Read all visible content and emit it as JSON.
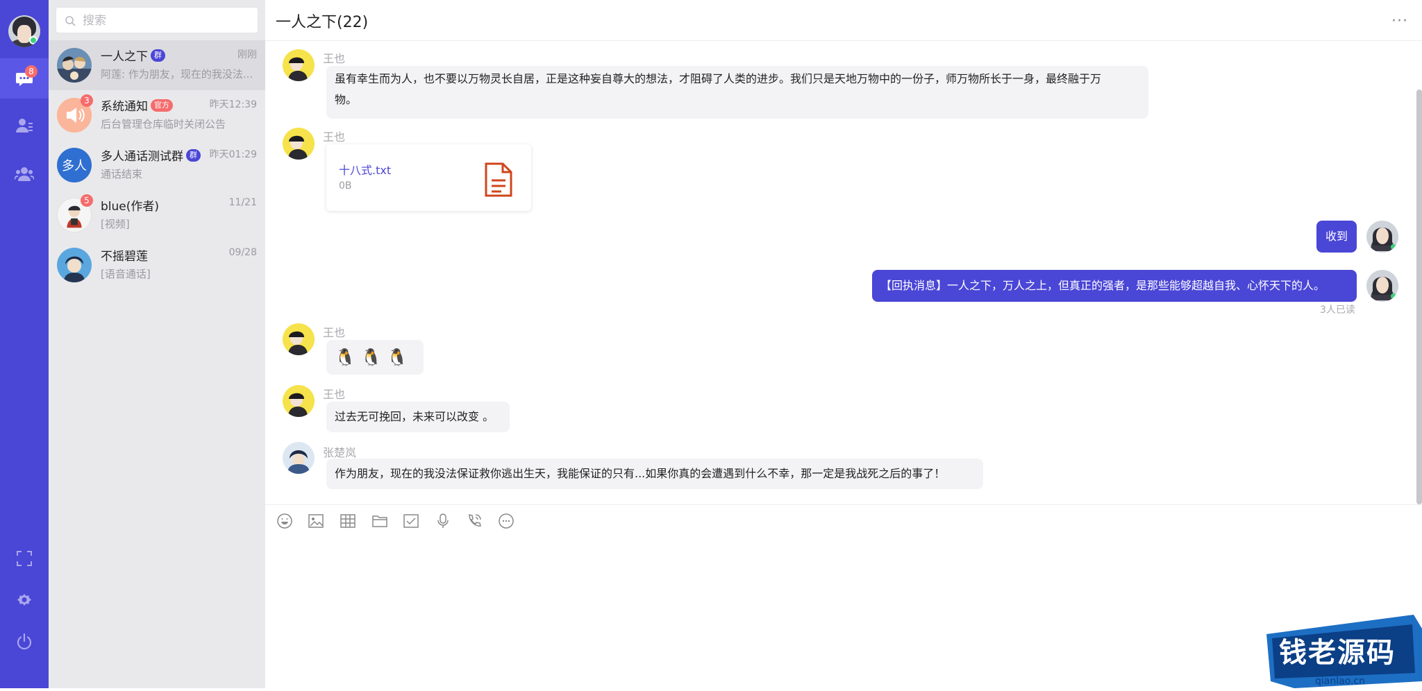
{
  "sidebar_rail": {
    "chat_badge": "8",
    "colors": {
      "rail": "#4a46d6",
      "active": "#5b57e6",
      "badge": "#f56c6c"
    },
    "icons": [
      "avatar",
      "chat-icon",
      "contacts-icon",
      "groups-icon",
      "fullscreen-icon",
      "gear-icon",
      "power-icon"
    ]
  },
  "search": {
    "placeholder": "搜索"
  },
  "conversations": [
    {
      "name": "一人之下",
      "tag": "群",
      "time": "刚刚",
      "preview": "阿莲: 作为朋友，现在的我没法...",
      "badge": ""
    },
    {
      "name": "系统通知",
      "tag": "官方",
      "time": "昨天12:39",
      "preview": "后台管理仓库临时关闭公告",
      "badge": "3"
    },
    {
      "name": "多人通话测试群",
      "tag": "群",
      "time": "昨天01:29",
      "preview": "通话结束",
      "badge": "",
      "avatar_text": "多人"
    },
    {
      "name": "blue(作者)",
      "tag": "",
      "time": "11/21",
      "preview": "[视频]",
      "badge": "5"
    },
    {
      "name": "不摇碧莲",
      "tag": "",
      "time": "09/28",
      "preview": "[语音通话]",
      "badge": ""
    }
  ],
  "chat": {
    "title": "一人之下(22)",
    "more": "···",
    "messages": [
      {
        "sender": "王也",
        "text": "虽有幸生而为人，也不要以万物灵长自居，正是这种妄自尊大的想法，才阻碍了人类的进步。我们只是天地万物中的一份子，师万物所长于一身，最终融于万",
        "text2": "物。"
      },
      {
        "sender": "王也",
        "file_name": "十八式.txt",
        "file_size": "0B"
      },
      {
        "mine": true,
        "text": "收到"
      },
      {
        "mine": true,
        "text": "【回执消息】一人之下，万人之上，但真正的强者，是那些能够超越自我、心怀天下的人。",
        "read": "3人已读"
      },
      {
        "sender": "王也",
        "emoji": "🐧 🐧 🐧"
      },
      {
        "sender": "王也",
        "text": "过去无可挽回，未来可以改变 。"
      },
      {
        "sender": "张楚岚",
        "text": "作为朋友，现在的我没法保证救你逃出生天，我能保证的只有...如果你真的会遭遇到什么不幸，那一定是我战死之后的事了！"
      }
    ]
  },
  "toolbar": [
    "emoji-icon",
    "image-icon",
    "table-icon",
    "folder-icon",
    "check-icon",
    "mic-icon",
    "phone-icon",
    "chat-bubble-icon"
  ],
  "watermark": {
    "title": "钱老源码",
    "url": "qianlao.cn"
  }
}
